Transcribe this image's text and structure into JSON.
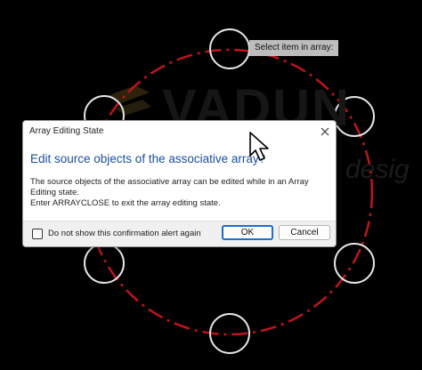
{
  "watermark": {
    "main": "VADUN",
    "sub": "desig"
  },
  "tooltip": {
    "text": "Select item in array:"
  },
  "dialog": {
    "title": "Array Editing State",
    "heading": "Edit source objects of the associative array?",
    "body_line1": "The source objects of the associative array can be edited while in an Array Editing state.",
    "body_line2": "Enter ARRAYCLOSE to exit the array editing state.",
    "checkbox_label": "Do not show this confirmation alert again",
    "checkbox_checked": false,
    "ok_label": "OK",
    "cancel_label": "Cancel"
  },
  "colors": {
    "background": "#000000",
    "array_circle": "#c0141c",
    "grip_circle": "#e6e6e6",
    "heading": "#1a4fa0",
    "ok_border": "#1b6fd1"
  },
  "icons": {
    "close": "close-icon",
    "cursor": "mouse-pointer-icon",
    "logo_mark": "logo-chevron-icon"
  }
}
